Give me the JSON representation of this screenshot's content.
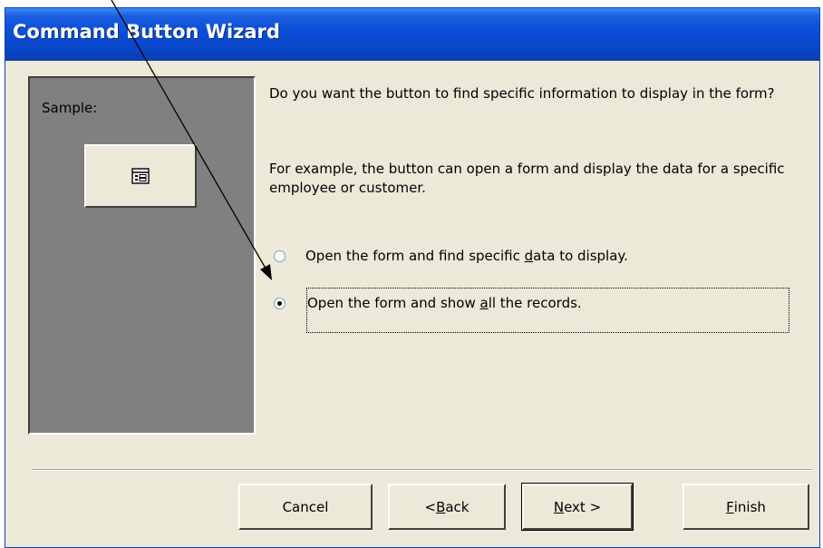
{
  "window": {
    "title": "Command Button Wizard"
  },
  "sample": {
    "label": "Sample:",
    "button_icon": "form-icon"
  },
  "content": {
    "question": "Do you want the button to find specific information to display in the form?",
    "example": "For example, the button can open a form and display the data for a specific employee or customer."
  },
  "options": [
    {
      "pre": "Open the form and find specific ",
      "accel": "d",
      "post": "ata to display.",
      "selected": false
    },
    {
      "pre": "Open the form and show ",
      "accel": "a",
      "post": "ll the records.",
      "selected": true
    }
  ],
  "buttons": {
    "cancel": {
      "label": "Cancel"
    },
    "back": {
      "pre": "< ",
      "accel": "B",
      "post": "ack"
    },
    "next": {
      "pre": "",
      "accel": "N",
      "post": "ext >"
    },
    "finish": {
      "pre": "",
      "accel": "F",
      "post": "inish"
    }
  },
  "colors": {
    "titlebar": "#0a4ed8",
    "dialog_bg": "#ece9d8",
    "sample_bg": "#808080"
  }
}
